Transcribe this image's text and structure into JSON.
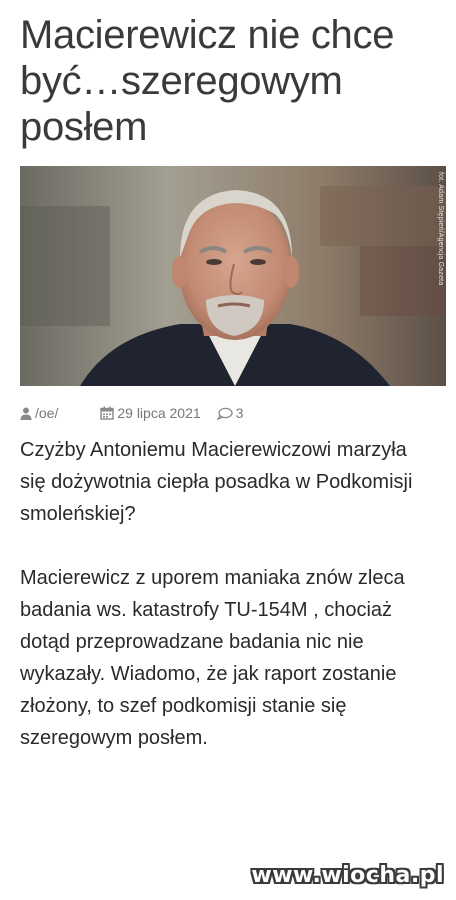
{
  "article": {
    "title": "Macierewicz nie chce być…szeregowym posłem",
    "image": {
      "credit": "fot. Adam Stępień/Agencja Gazeta"
    },
    "meta": {
      "author": "/oe/",
      "date": "29 lipca 2021",
      "comments": "3",
      "icons": [
        "user-icon",
        "calendar-icon",
        "comment-icon"
      ]
    },
    "paragraphs": [
      "Czyżby Antoniemu Macierewiczowi marzyła się dożywotnia ciepła posadka w Podkomisji smoleńskiej?",
      "Macierewicz z uporem maniaka znów zleca badania ws. katastrofy TU-154M , chociaż dotąd przeprowadzane badania nic nie wykazały.  Wiadomo, że  jak raport zostanie złożony, to szef podkomisji stanie się szeregowym posłem."
    ]
  },
  "watermark": "www.wiocha.pl",
  "colors": {
    "title": "#3a3a3a",
    "meta": "#777777",
    "body": "#2a2a2a"
  }
}
